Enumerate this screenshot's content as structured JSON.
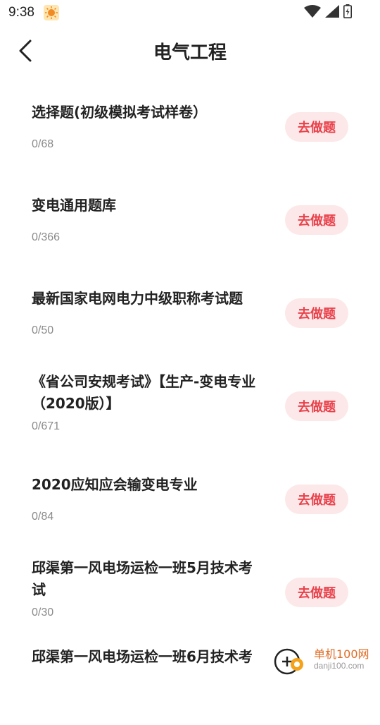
{
  "status_bar": {
    "time": "9:38"
  },
  "header": {
    "title": "电气工程"
  },
  "items": [
    {
      "title": "选择题(初级模拟考试样卷）",
      "count": "0/68",
      "action": "去做题"
    },
    {
      "title": "变电通用题库",
      "count": "0/366",
      "action": "去做题"
    },
    {
      "title": "最新国家电网电力中级职称考试题",
      "count": "0/50",
      "action": "去做题"
    },
    {
      "title": "《省公司安规考试》【生产-变电专业（2020版）】",
      "count": "0/671",
      "action": "去做题"
    },
    {
      "title": "2020应知应会输变电专业",
      "count": "0/84",
      "action": "去做题"
    },
    {
      "title": "邱渠第一风电场运检一班5月技术考试",
      "count": "0/30",
      "action": "去做题"
    },
    {
      "title": "邱渠第一风电场运检一班6月技术考",
      "count": "",
      "action": ""
    }
  ],
  "watermark": {
    "name": "单机100网",
    "url": "danji100.com"
  },
  "colors": {
    "accent": "#e8414a",
    "button_bg": "#fde8e9",
    "count_gray": "#8a8a8a"
  }
}
